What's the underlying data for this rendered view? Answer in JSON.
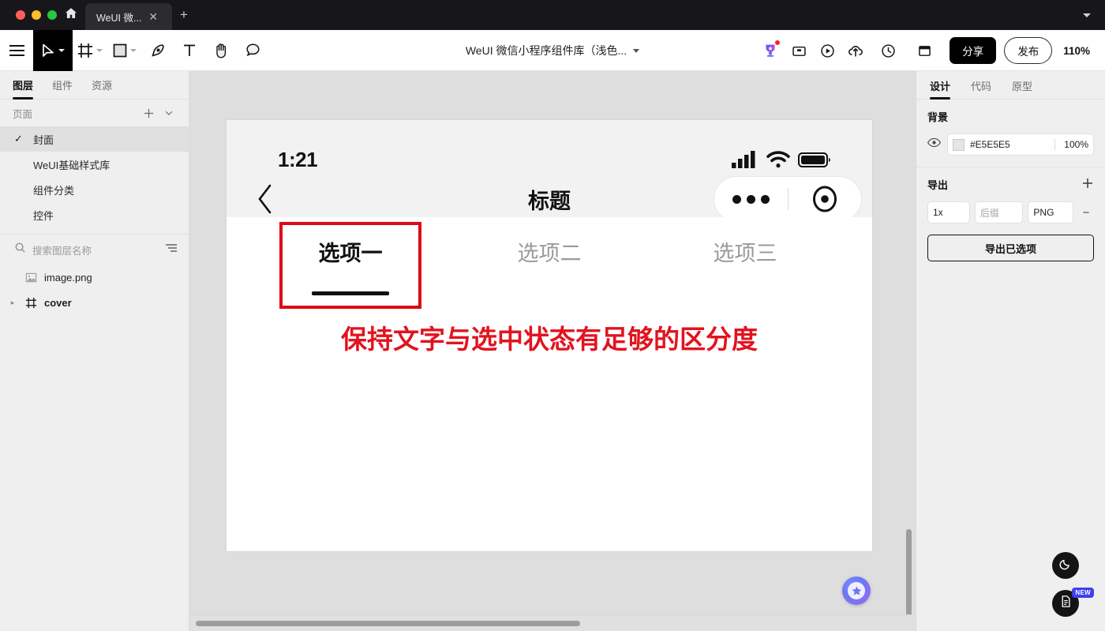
{
  "window": {
    "traffic_lights": [
      "close-red",
      "minimize-yellow",
      "maximize-green"
    ],
    "home_icon": "home-icon",
    "tab_label": "WeUI 微...",
    "tab_close": "✕",
    "new_tab": "+",
    "window_menu_icon": "chevron-down-icon"
  },
  "toolbar": {
    "menu_icon": "hamburger-menu-icon",
    "tools": [
      {
        "name": "move-tool",
        "icon": "cursor-arrow-icon",
        "selected": true,
        "has_caret": true
      },
      {
        "name": "frame-tool",
        "icon": "frame-icon",
        "selected": false,
        "has_caret": true
      },
      {
        "name": "shape-tool",
        "icon": "rectangle-icon",
        "selected": false,
        "has_caret": true
      },
      {
        "name": "pen-tool",
        "icon": "pen-nib-icon",
        "selected": false,
        "has_caret": false
      },
      {
        "name": "text-tool",
        "icon": "text-t-icon",
        "selected": false,
        "has_caret": false
      },
      {
        "name": "hand-tool",
        "icon": "hand-icon",
        "selected": false,
        "has_caret": false
      },
      {
        "name": "comment-tool",
        "icon": "comment-bubble-icon",
        "selected": false,
        "has_caret": false
      }
    ],
    "document_title": "WeUI 微信小程序组件库（浅色...",
    "title_caret": "chevron-down-icon",
    "right_icons": [
      {
        "name": "trophy-icon",
        "badge": true
      },
      {
        "name": "archive-box-icon",
        "badge": false
      },
      {
        "name": "play-circle-icon",
        "badge": false
      },
      {
        "name": "cloud-upload-icon",
        "badge": false
      },
      {
        "name": "history-clock-icon",
        "badge": false,
        "has_caret": true
      },
      {
        "name": "layout-panel-icon",
        "badge": false,
        "has_caret": true
      }
    ],
    "share_label": "分享",
    "publish_label": "发布",
    "zoom_level": "110%",
    "zoom_caret": "chevron-down-icon"
  },
  "left_panel": {
    "tabs": [
      {
        "label": "图层",
        "active": true
      },
      {
        "label": "组件",
        "active": false
      },
      {
        "label": "资源",
        "active": false
      }
    ],
    "pages_section": {
      "label": "页面",
      "add_icon": "plus-icon",
      "collapse_icon": "chevron-down-icon"
    },
    "pages": [
      {
        "label": "封面",
        "selected": true,
        "check": "✓"
      },
      {
        "label": "WeUI基础样式库",
        "selected": false,
        "check": ""
      },
      {
        "label": "组件分类",
        "selected": false,
        "check": ""
      },
      {
        "label": "控件",
        "selected": false,
        "check": ""
      }
    ],
    "search": {
      "icon": "search-icon",
      "placeholder": "搜索图层名称",
      "filter_icon": "sort-filter-icon"
    },
    "layers": [
      {
        "label": "image.png",
        "icon": "image-icon",
        "twisty": "",
        "bold": false
      },
      {
        "label": "cover",
        "icon": "frame-icon",
        "twisty": "▸",
        "bold": true
      }
    ]
  },
  "canvas": {
    "background_color": "#DEDEDE",
    "artboard_bg": "#FFFFFF",
    "phone_header_bg": "#F2F2F2",
    "status_bar": {
      "time": "1:21",
      "icons": [
        "cellular-signal-icon",
        "wifi-icon",
        "battery-icon"
      ]
    },
    "nav_bar": {
      "back_icon": "chevron-left-icon",
      "title": "标题",
      "capsule": {
        "more_icon": "more-dots-icon",
        "target_icon": "target-circle-icon"
      }
    },
    "tabs": [
      {
        "label": "选项一",
        "active": true
      },
      {
        "label": "选项二",
        "active": false
      },
      {
        "label": "选项三",
        "active": false
      }
    ],
    "annotation": {
      "text": "保持文字与选中状态有足够的区分度",
      "color": "#E2131F",
      "highlight_box_color": "#DD0A17"
    },
    "badge_icon": "star-badge-icon"
  },
  "right_panel": {
    "tabs": [
      {
        "label": "设计",
        "active": true
      },
      {
        "label": "代码",
        "active": false
      },
      {
        "label": "原型",
        "active": false
      }
    ],
    "background": {
      "section_title": "背景",
      "visibility_icon": "eye-icon",
      "swatch_color": "#E5E5E5",
      "hex": "#E5E5E5",
      "opacity": "100%"
    },
    "export": {
      "section_title": "导出",
      "add_icon": "plus-icon",
      "scale": "1x",
      "suffix_placeholder": "后缀",
      "format": "PNG",
      "remove_icon": "minus-icon",
      "button_label": "导出已选项"
    }
  },
  "fabs": [
    {
      "name": "dark-mode-fab",
      "icon": "moon-icon",
      "badge": null
    },
    {
      "name": "docs-fab",
      "icon": "document-icon",
      "badge": "NEW"
    }
  ]
}
